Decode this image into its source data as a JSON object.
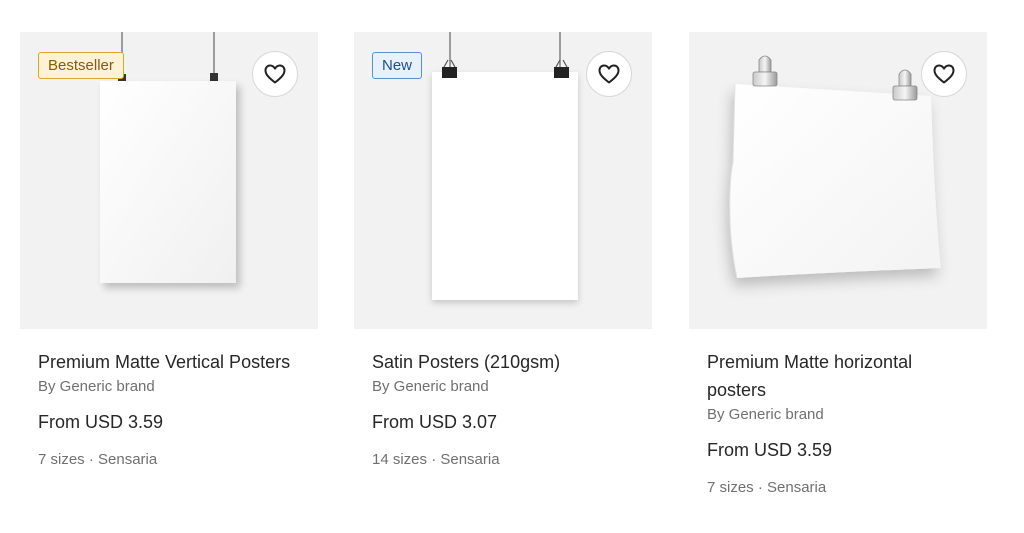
{
  "products": [
    {
      "badge": "Bestseller",
      "title": "Premium Matte Vertical Posters",
      "brand": "By Generic brand",
      "price": "From USD 3.59",
      "meta": "7 sizes · Sensaria",
      "favorite_icon": "heart-outline-icon"
    },
    {
      "badge": "New",
      "title": "Satin Posters (210gsm)",
      "brand": "By Generic brand",
      "price": "From USD 3.07",
      "meta": "14 sizes · Sensaria",
      "favorite_icon": "heart-outline-icon"
    },
    {
      "badge": "",
      "title": "Premium Matte horizontal posters",
      "brand": "By Generic brand",
      "price": "From USD 3.59",
      "meta": "7 sizes · Sensaria",
      "favorite_icon": "heart-outline-icon"
    }
  ]
}
